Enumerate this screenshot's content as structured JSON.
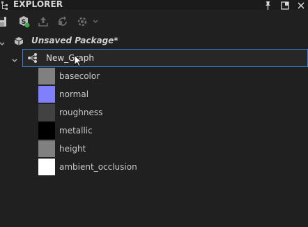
{
  "panel": {
    "title": "EXPLORER"
  },
  "toolbar": {
    "buttons": [
      "save-icon",
      "new-substance-icon",
      "export-icon",
      "refresh-icon",
      "settings-dropdown-icon"
    ]
  },
  "tree": {
    "package": {
      "label": "Unsaved Package*",
      "expanded": true
    },
    "graph": {
      "label": "New_Graph",
      "expanded": true,
      "selected": true
    },
    "outputs": [
      {
        "label": "basecolor",
        "color": "#808080"
      },
      {
        "label": "normal",
        "color": "#8080ff"
      },
      {
        "label": "roughness",
        "color": "#424242"
      },
      {
        "label": "metallic",
        "color": "#000000"
      },
      {
        "label": "height",
        "color": "#808080"
      },
      {
        "label": "ambient_occlusion",
        "color": "#ffffff"
      }
    ]
  },
  "colors": {
    "background": "#202020",
    "selection_border": "#3e7fd6"
  }
}
